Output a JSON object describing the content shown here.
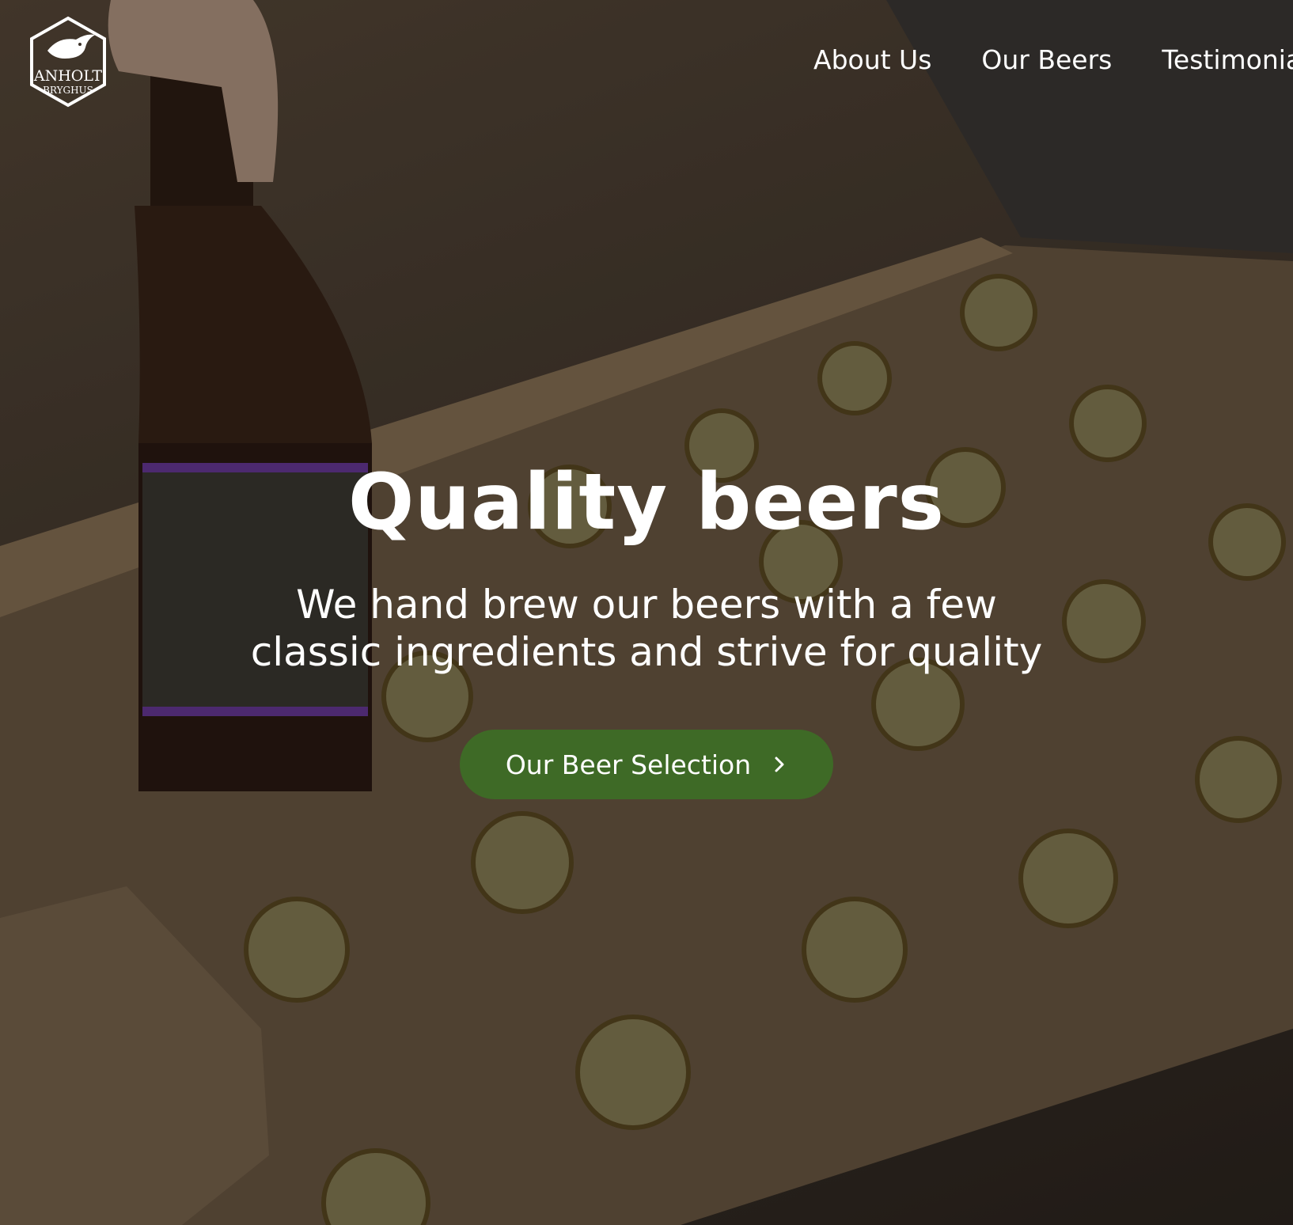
{
  "brand": {
    "logo_line1": "ANHOLT",
    "logo_line2": "BRYGHUS"
  },
  "nav": {
    "items": [
      {
        "label": "About Us"
      },
      {
        "label": "Our Beers"
      },
      {
        "label": "Testimonia"
      }
    ]
  },
  "hero": {
    "headline": "Quality beers",
    "subtext": "We hand brew our beers with a few classic ingredients and strive for quality",
    "cta_label": "Our Beer Selection",
    "cta_icon": "chevron-right-icon"
  },
  "colors": {
    "cta_background": "#3e6a26",
    "text": "#ffffff"
  }
}
